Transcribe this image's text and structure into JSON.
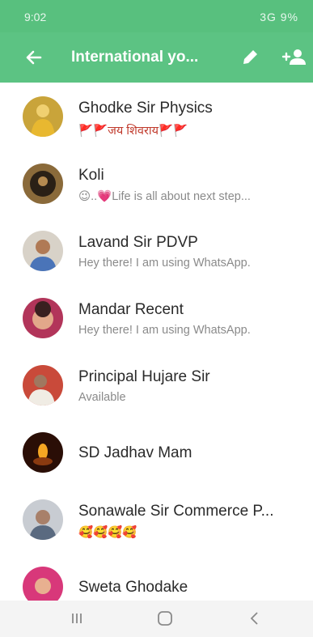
{
  "status_bar": {
    "time": "9:02",
    "system": "3G 9%"
  },
  "header": {
    "title": "International yo..."
  },
  "contacts": [
    {
      "name": "Ghodke Sir Physics",
      "status": "🚩🚩जय शिवराय🚩🚩"
    },
    {
      "name": "Koli",
      "status": "😉..💗Life is all about next step..."
    },
    {
      "name": "Lavand Sir PDVP",
      "status": "Hey there! I am using WhatsApp."
    },
    {
      "name": "Mandar Recent",
      "status": "Hey there! I am using WhatsApp."
    },
    {
      "name": "Principal Hujare Sir",
      "status": "Available"
    },
    {
      "name": "SD Jadhav Mam",
      "status": ""
    },
    {
      "name": "Sonawale Sir Commerce P...",
      "status": "🥰🥰🥰🥰"
    },
    {
      "name": "Sweta Ghodake",
      "status": ""
    }
  ],
  "colors": {
    "accent": "#5cc383",
    "status_bar": "#58c07e"
  },
  "icons": {
    "back": "arrow-left-icon",
    "edit": "pencil-icon",
    "add_user": "add-person-icon",
    "nav_recents": "recents-icon",
    "nav_home": "home-icon",
    "nav_back": "nav-back-icon"
  }
}
